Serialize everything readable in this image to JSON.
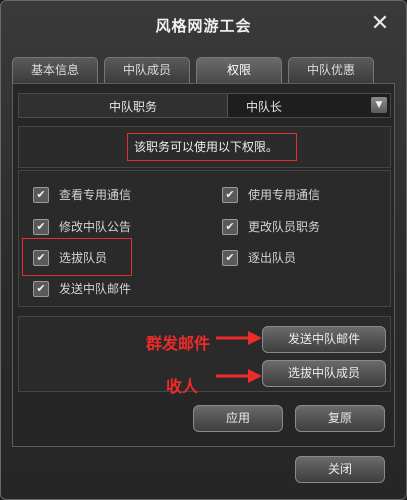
{
  "window": {
    "title": "风格网游工会",
    "close_glyph": "✕"
  },
  "tabs": [
    {
      "label": "基本信息",
      "active": false
    },
    {
      "label": "中队成员",
      "active": false
    },
    {
      "label": "权限",
      "active": true
    },
    {
      "label": "中队优惠",
      "active": false
    }
  ],
  "rank": {
    "label": "中队职务",
    "value": "中队长",
    "dropdown_icon": "▼"
  },
  "permission_note": "该职务可以使用以下权限。",
  "permissions": [
    {
      "label": "查看专用通信",
      "checked": true
    },
    {
      "label": "使用专用通信",
      "checked": true
    },
    {
      "label": "修改中队公告",
      "checked": true
    },
    {
      "label": "更改队员职务",
      "checked": true
    },
    {
      "label": "选拔队员",
      "checked": true
    },
    {
      "label": "逐出队员",
      "checked": true
    },
    {
      "label": "发送中队邮件",
      "checked": true
    }
  ],
  "actions": {
    "send_mail": "发送中队邮件",
    "select_member": "选拔中队成员"
  },
  "annotations": {
    "mass_mail": "群发邮件",
    "recruit": "收人"
  },
  "footer": {
    "apply": "应用",
    "reset": "复原",
    "close": "关闭"
  },
  "colors": {
    "highlight": "#e03030",
    "annotation": "#ee2a2a"
  }
}
